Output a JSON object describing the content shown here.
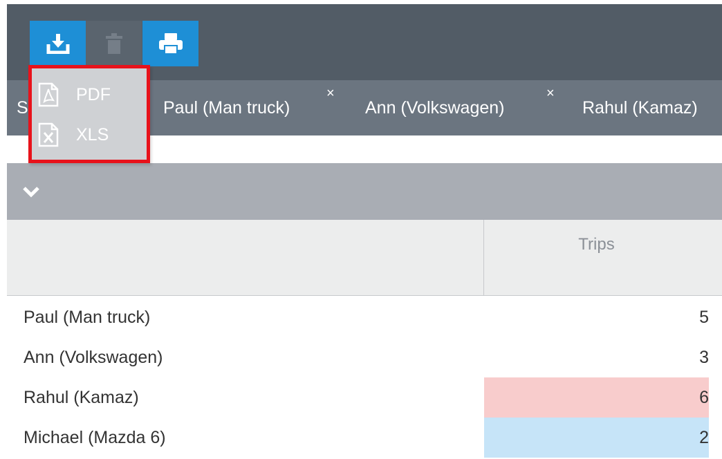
{
  "toolbar": {
    "buttons": [
      {
        "icon": "download-icon",
        "color": "#1e8fd6"
      },
      {
        "icon": "trash-icon",
        "color": "#5a646e"
      },
      {
        "icon": "printer-icon",
        "color": "#1e8fd6"
      }
    ]
  },
  "export_menu": {
    "items": [
      {
        "label": "PDF",
        "icon": "pdf-file-icon"
      },
      {
        "label": "XLS",
        "icon": "xls-file-icon"
      }
    ],
    "highlight_color": "#e8121b"
  },
  "tabs": [
    {
      "label": "S",
      "close": "×"
    },
    {
      "label": "Paul (Man truck)",
      "close": "×"
    },
    {
      "label": "Ann (Volkswagen)",
      "close": "×"
    },
    {
      "label": "Rahul (Kamaz)"
    }
  ],
  "filter": {
    "icon": "chevron-down-icon"
  },
  "table": {
    "columns": [
      "",
      "Trips"
    ],
    "rows": [
      {
        "name": "Paul (Man truck)",
        "trips": "5",
        "highlight": "#ffffff"
      },
      {
        "name": "Ann (Volkswagen)",
        "trips": "3",
        "highlight": "#ffffff"
      },
      {
        "name": "Rahul (Kamaz)",
        "trips": "6",
        "highlight": "#f8cccc"
      },
      {
        "name": "Michael (Mazda 6)",
        "trips": "2",
        "highlight": "#c6e4f8"
      }
    ]
  }
}
